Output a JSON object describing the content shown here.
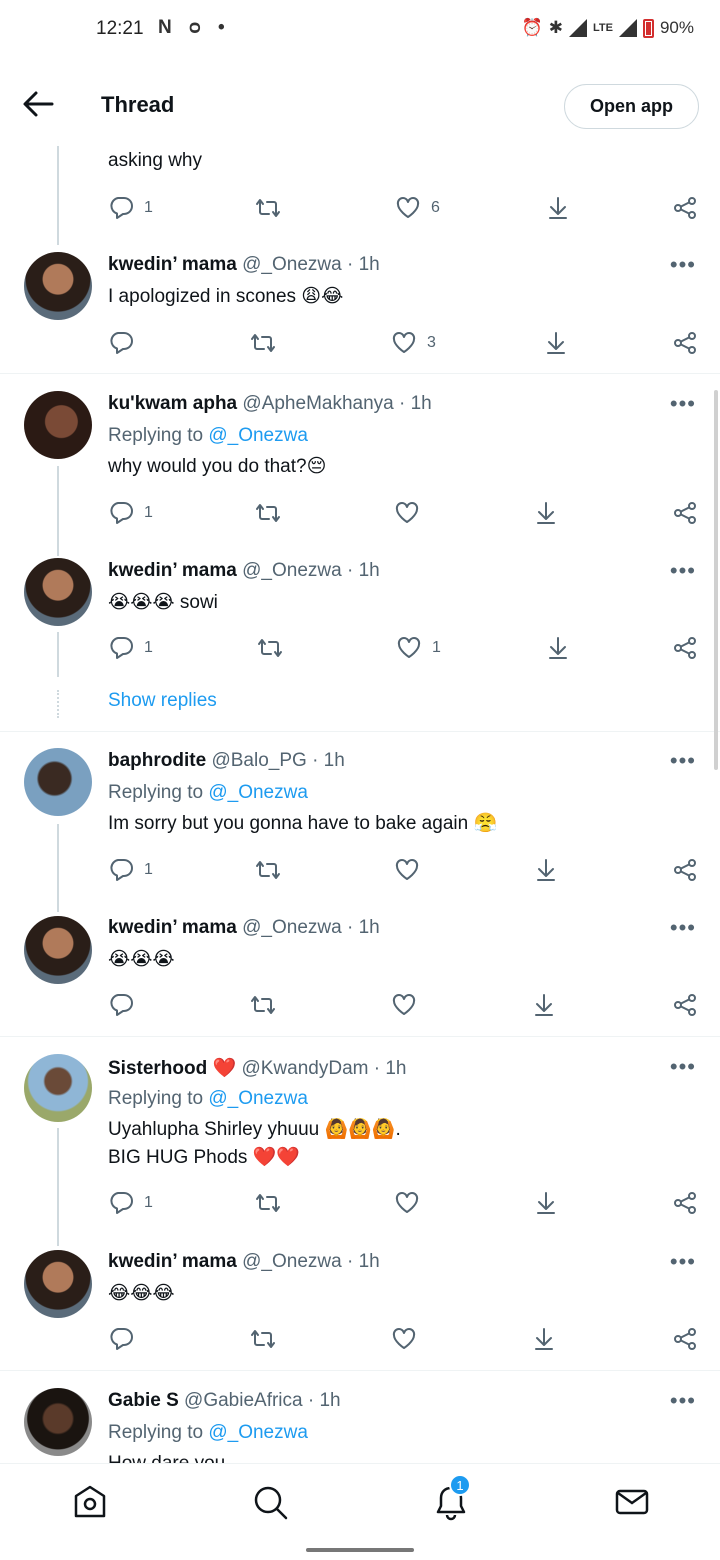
{
  "status_bar": {
    "time": "12:21",
    "left_icons": "N ᴑ •",
    "network": "LTE",
    "battery": "90%"
  },
  "header": {
    "title": "Thread",
    "open_app": "Open app"
  },
  "partial_tweet": {
    "text": "asking why",
    "reply_count": "1",
    "like_count": "6"
  },
  "tweets": [
    {
      "name": "kwedin’ mama",
      "handle": "@_Onezwa · 1h",
      "replying": "",
      "text": "I apologized in scones",
      "emoji": "😩😂",
      "reply_count": "",
      "like_count": "3"
    },
    {
      "name": "ku'kwam apha",
      "handle": "@ApheMakhanya · 1h",
      "replying_prefix": "Replying to",
      "replying_to": "@_Onezwa",
      "text": "why would you do that?",
      "emoji": "😔",
      "reply_count": "1",
      "like_count": ""
    },
    {
      "name": "kwedin’ mama",
      "handle": "@_Onezwa · 1h",
      "text": "sowi",
      "emoji": "😭😭😭",
      "reply_count": "1",
      "like_count": "1"
    },
    {
      "name": "baphrodite",
      "handle": "@Balo_PG · 1h",
      "replying_prefix": "Replying to",
      "replying_to": "@_Onezwa",
      "text": "Im sorry but you gonna have to bake again",
      "emoji": "😤",
      "reply_count": "1",
      "like_count": ""
    },
    {
      "name": "kwedin’ mama",
      "handle": "@_Onezwa · 1h",
      "text": "",
      "emoji": "😭😭😭",
      "reply_count": "",
      "like_count": ""
    },
    {
      "name": "Sisterhood",
      "name_emoji": "❤️",
      "handle": "@KwandyDam · 1h",
      "replying_prefix": "Replying to",
      "replying_to": "@_Onezwa",
      "text": "Uyahlupha Shirley yhuuu",
      "emoji": "🙆🙆🙆.",
      "text2": "BIG HUG Phods",
      "emoji2": "❤️❤️",
      "reply_count": "1",
      "like_count": ""
    },
    {
      "name": "kwedin’ mama",
      "handle": "@_Onezwa · 1h",
      "text": "",
      "emoji": "😂😂😂",
      "reply_count": "",
      "like_count": ""
    },
    {
      "name": "Gabie S",
      "handle": "@GabieAfrica · 1h",
      "replying_prefix": "Replying to",
      "replying_to": "@_Onezwa",
      "text": "How dare you"
    }
  ],
  "show_replies": "Show replies",
  "bottom_nav": {
    "notifications_badge": "1"
  }
}
